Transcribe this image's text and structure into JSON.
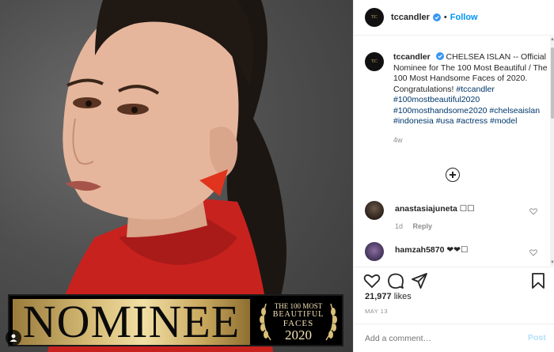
{
  "photo": {
    "banner_text": "NOMINEE",
    "badge_line1": "THE 100 MOST",
    "badge_line2": "BEAUTIFUL",
    "badge_line3": "FACES",
    "badge_line4": "2020",
    "user_tag_icon": "user-icon"
  },
  "header": {
    "username": "tccandler",
    "separator": "•",
    "follow_label": "Follow",
    "avatar_text": "TC"
  },
  "caption": {
    "username": "tccandler",
    "text": "CHELSEA ISLAN -- Official Nominee for The 100 Most Beautiful / The 100 Most Handsome Faces of 2020. Congratulations!",
    "hashtags": "#tccandler #100mostbeautiful2020 #100mosthandsome2020 #chelseaislan #indonesia #usa #actress #model",
    "time": "4w"
  },
  "comments": [
    {
      "username": "anastasiajuneta",
      "text": "☐☐",
      "time": "1d",
      "reply_label": "Reply"
    },
    {
      "username": "hamzah5870",
      "text": "❤❤☐"
    }
  ],
  "actions": {
    "likes_count": "21,977",
    "likes_label": "likes",
    "date": "MAY 13"
  },
  "add_comment": {
    "placeholder": "Add a comment…",
    "post_label": "Post"
  },
  "colors": {
    "link_blue": "#0095f6",
    "hashtag": "#00376b",
    "muted": "#8e8e8e",
    "banner_gold": "#d9bf7a"
  }
}
